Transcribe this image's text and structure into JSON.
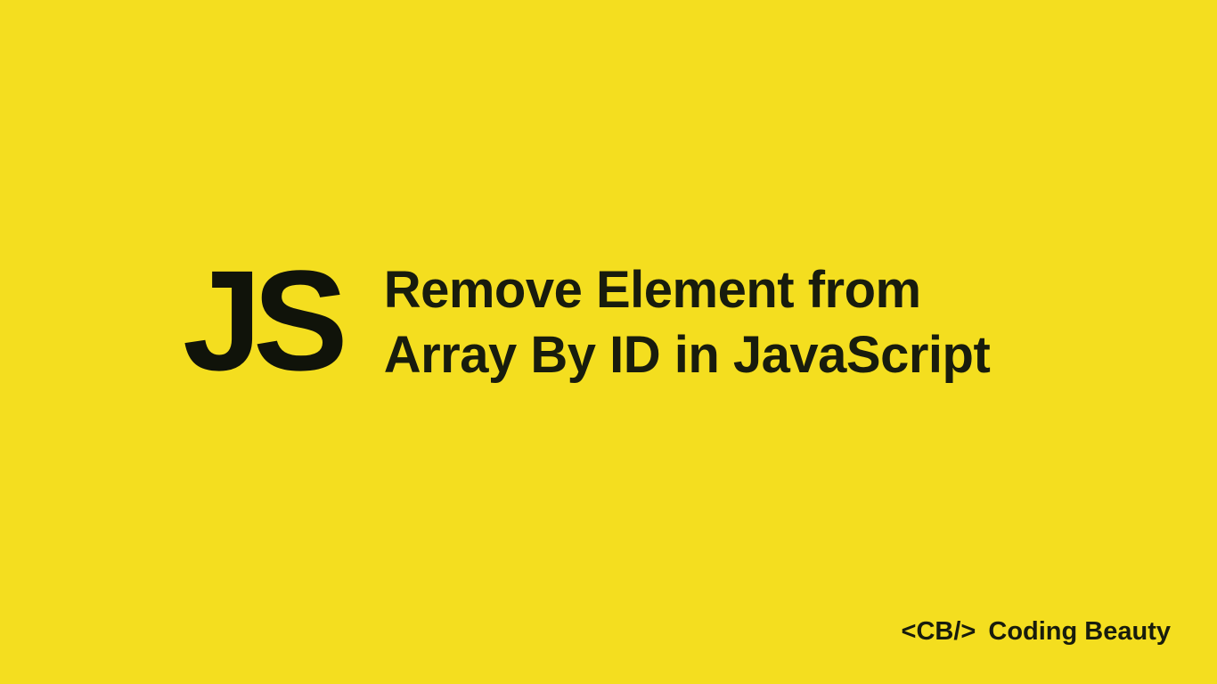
{
  "logo": {
    "text": "JS"
  },
  "title": {
    "line1": "Remove Element from",
    "line2": "Array By ID in JavaScript"
  },
  "brand": {
    "tag": "<CB/>",
    "name": "Coding Beauty"
  },
  "colors": {
    "background": "#f4de1f",
    "text": "#181c0d"
  }
}
